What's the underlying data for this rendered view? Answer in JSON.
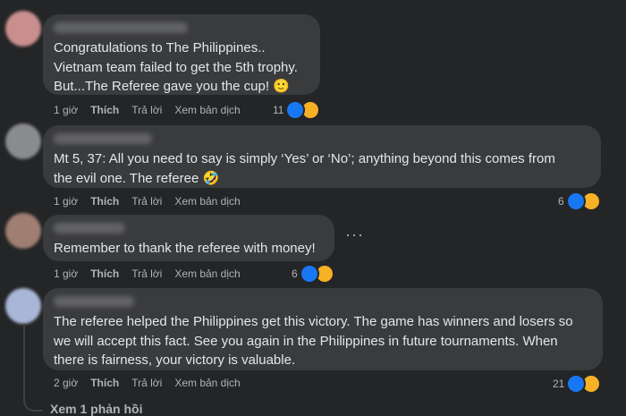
{
  "comments": [
    {
      "text": "Congratulations to The Philippines..\nVietnam team failed to get the 5th trophy.\nBut...The Referee gave you the cup! 🙂",
      "time": "1 giờ",
      "like": "Thích",
      "reply": "Trả lời",
      "translate": "Xem bản dịch",
      "reactions": "11"
    },
    {
      "text": "Mt 5, 37: All you need to say is simply ‘Yes’ or ‘No’; anything beyond this comes from\nthe evil one. The referee 🤣",
      "time": "1 giờ",
      "like": "Thích",
      "reply": "Trả lời",
      "translate": "Xem bản dịch",
      "reactions": "6"
    },
    {
      "text": "Remember to thank the referee with money!",
      "time": "1 giờ",
      "like": "Thích",
      "reply": "Trả lời",
      "translate": "Xem bản dịch",
      "reactions": "6"
    },
    {
      "text": "The referee helped the Philippines get this victory. The game has winners and losers so\nwe will accept this fact. See you again in the Philippines in future tournaments. When\nthere is fairness, your victory is valuable.",
      "time": "2 giờ",
      "like": "Thích",
      "reply": "Trả lời",
      "translate": "Xem bản dịch",
      "reactions": "21"
    }
  ],
  "view_replies": "Xem 1 phản hồi",
  "more_options": "···",
  "colors": {
    "background": "#242526",
    "bubble": "#3a3b3c",
    "like_blue": "#1877f2",
    "haha_yellow": "#f7b125"
  },
  "icons": {
    "like": "thumbs-up-icon",
    "haha": "laughing-face-icon",
    "more": "ellipsis-icon"
  }
}
